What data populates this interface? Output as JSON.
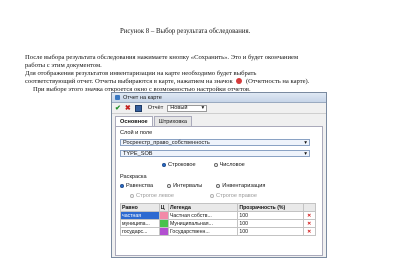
{
  "document": {
    "caption": "Рисунок 8 – Выбор результата обследования.",
    "paragraph_1": "После выбора результата обследования нажимаете кнопку «Сохранить». Это и будет окончанием",
    "paragraph_1_cont": "работы с этим документом.",
    "paragraph_2": "Для отображения результатов инвентаризации на карте необходимо будет выбрать",
    "paragraph_2_cont_a": "соответствующий отчет. Отчеты выбираются в карте, нажатием на значок",
    "paragraph_2_cont_b": "(Отчетность на карте).",
    "paragraph_3": "При выборе этого значка откроется окно с возможностью настройки отчетов."
  },
  "dialog": {
    "title": "Отчет на карте",
    "toolbar": {
      "select_label": "Отчёт",
      "select_value": "Новый"
    },
    "tabs": [
      "Основное",
      "Штриховка"
    ],
    "layer_field_label": "Слой и поле",
    "layer_value": "Росреестр_право_собственность",
    "field_value": "TYPE_SOB",
    "value_type": {
      "string": "Строковое",
      "numeric": "Числовое"
    },
    "coloring_label": "Раскраска",
    "coloring": {
      "equal": "Равенства",
      "intervals": "Интервалы",
      "inventory": "Инвентаризация"
    },
    "inventory_options": {
      "strict_left": "Строгое левое",
      "strict_right": "Строгое правое"
    },
    "table": {
      "headers": [
        "Равно",
        "Ц",
        "Легенда",
        "Прозрачность (%)",
        ""
      ],
      "rows": [
        {
          "equals": "частная",
          "legend": "Частная собств...",
          "transparency": "100",
          "color": "#f28aa8"
        },
        {
          "equals": "муниципа...",
          "legend": "Муниципальная...",
          "transparency": "100",
          "color": "#49c24d"
        },
        {
          "equals": "государс...",
          "legend": "Государственн...",
          "transparency": "100",
          "color": "#b24fd0"
        }
      ]
    }
  },
  "colors": {
    "accent": "#2d6ad1",
    "delete": "#d01010"
  }
}
